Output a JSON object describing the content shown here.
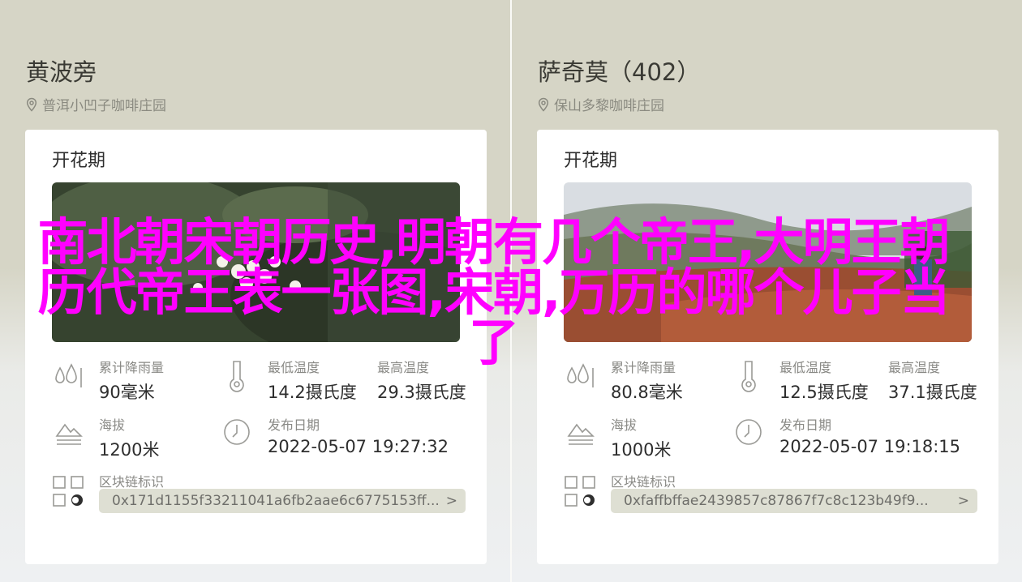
{
  "cards": [
    {
      "farm_name": "黄波旁",
      "location": "普洱小凹子咖啡庄园",
      "section_title": "开花期",
      "stats": {
        "rain_label": "累计降雨量",
        "rain_value": "90毫米",
        "min_temp_label": "最低温度",
        "min_temp_value": "14.2摄氏度",
        "max_temp_label": "最高温度",
        "max_temp_value": "29.3摄氏度",
        "altitude_label": "海拔",
        "altitude_value": "1200米",
        "date_label": "发布日期",
        "date_value": "2022-05-07 19:27:32",
        "chain_label": "区块链标识",
        "chain_value": "0x171d1155f33211041a6fb2aae6c6775153ff..."
      }
    },
    {
      "farm_name": "萨奇莫（402）",
      "location": "保山多黎咖啡庄园",
      "section_title": "开花期",
      "stats": {
        "rain_label": "累计降雨量",
        "rain_value": "80.8毫米",
        "min_temp_label": "最低温度",
        "min_temp_value": "12.5摄氏度",
        "max_temp_label": "最高温度",
        "max_temp_value": "37.1摄氏度",
        "altitude_label": "海拔",
        "altitude_value": "1000米",
        "date_label": "发布日期",
        "date_value": "2022-05-07 19:18:15",
        "chain_label": "区块链标识",
        "chain_value": "0xfaffbffae2439857c87867f7c8c123b49f9..."
      }
    }
  ],
  "overlay_title": "南北朝宋朝历史,明朝有几个帝王,大明王朝历代帝王表一张图,宋朝,万历的哪个儿子当了",
  "chevron": ">",
  "colors": {
    "overlay": "#ff00ff",
    "panel_bg": "#d6d5c6",
    "card_bg": "#ffffff"
  }
}
